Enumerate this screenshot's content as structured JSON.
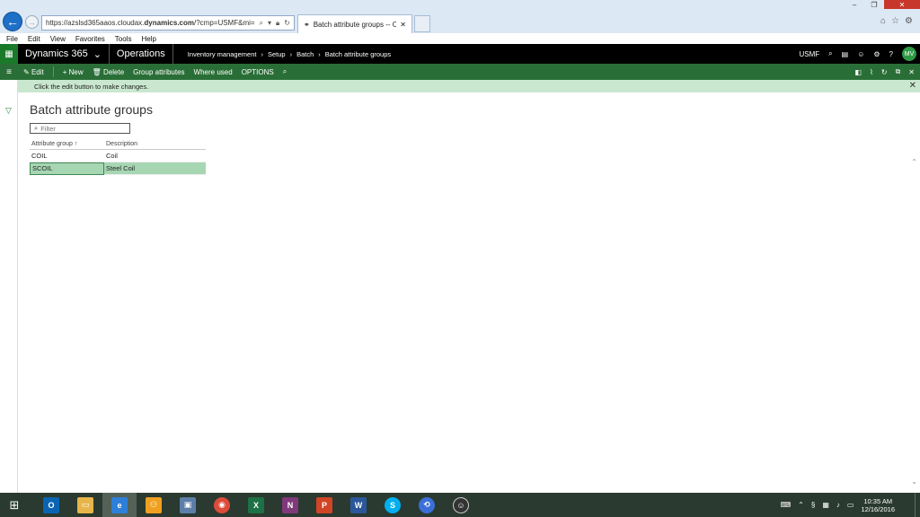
{
  "browser": {
    "url_prefix": "https://azslsd365aaos.cloudax.",
    "url_bold": "dynamics.com",
    "url_suffix": "/?cmp=USMF&mi=",
    "tab_title": "Batch attribute groups -- O...",
    "menu": [
      "File",
      "Edit",
      "View",
      "Favorites",
      "Tools",
      "Help"
    ]
  },
  "nav": {
    "brand": "Dynamics 365",
    "module": "Operations",
    "breadcrumbs": [
      "Inventory management",
      "Setup",
      "Batch",
      "Batch attribute groups"
    ],
    "company": "USMF",
    "avatar_initials": "MV"
  },
  "actions": {
    "edit": "Edit",
    "new": "New",
    "delete": "Delete",
    "group_attributes": "Group attributes",
    "where_used": "Where used",
    "options": "OPTIONS"
  },
  "message": "Click the edit button to make changes.",
  "page": {
    "title": "Batch attribute groups",
    "filter_placeholder": "Filter"
  },
  "grid": {
    "columns": [
      "Attribute group",
      "Description"
    ],
    "rows": [
      {
        "group": "COIL",
        "description": "Coil"
      },
      {
        "group": "SCOIL",
        "description": "Steel Coil"
      }
    ]
  },
  "taskbar": {
    "clock_time": "10:35 AM",
    "clock_date": "12/16/2016"
  }
}
